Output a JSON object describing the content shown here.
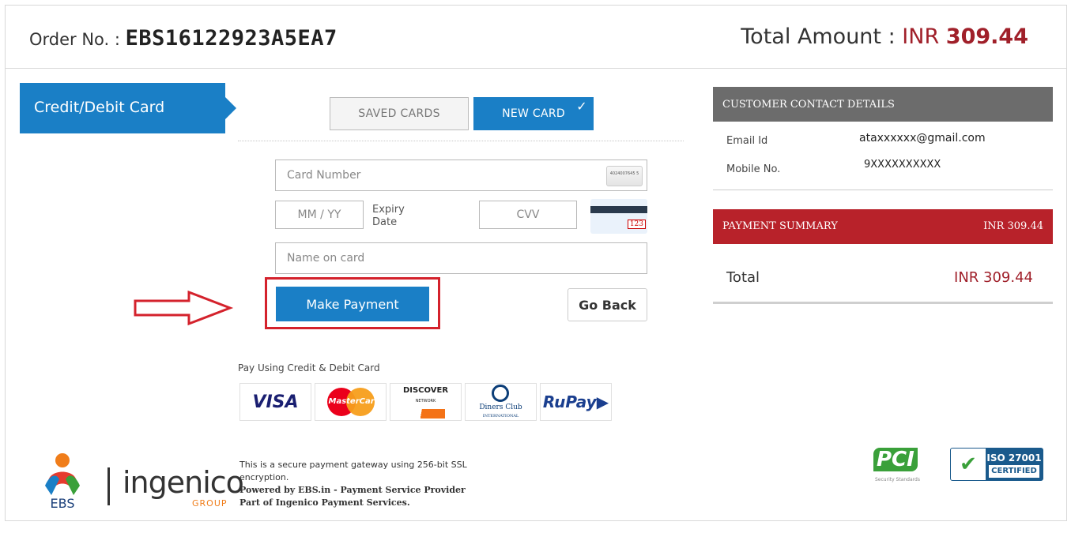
{
  "header": {
    "order_label": "Order No. : ",
    "order_number": "EBS16122923A5EA7",
    "total_label": "Total Amount : ",
    "total_currency": "INR ",
    "total_amount": "309.44"
  },
  "side_tab": {
    "label": "Credit/Debit Card"
  },
  "card_tabs": {
    "saved": "SAVED CARDS",
    "new": "NEW CARD",
    "new_check": "✓"
  },
  "form": {
    "card_number_placeholder": "Card Number",
    "mmyy_placeholder": "MM / YY",
    "expiry_label": "Expiry Date",
    "cvv_placeholder": "CVV",
    "name_placeholder": "Name on card",
    "cvv_sample": "123",
    "card_sample": "4024007645 5"
  },
  "buttons": {
    "make_payment": "Make Payment",
    "go_back": "Go Back"
  },
  "pay_using": {
    "label": "Pay Using Credit & Debit Card",
    "brands": {
      "visa": "VISA",
      "mastercard": "MasterCard",
      "discover": "DISCOVER",
      "discover_sub": "NETWORK",
      "diners": "Diners Club",
      "diners_sub": "INTERNATIONAL",
      "rupay": "RuPay"
    }
  },
  "footer": {
    "ebs": "EBS",
    "ingenico": "ingenico",
    "group": "GROUP",
    "secure_line1": "This is a secure payment gateway using 256-bit SSL encryption.",
    "secure_line2": "Powered by EBS.in - Payment Service Provider",
    "secure_line3": "Part of Ingenico Payment Services.",
    "pci": "PCI",
    "pci_sub": "Security Standards",
    "iso_line1": "ISO 27001",
    "iso_line2": "CERTIFIED"
  },
  "contact": {
    "header": "CUSTOMER CONTACT DETAILS",
    "email_label": "Email Id",
    "email_value": "ataxxxxxx@gmail.com",
    "mobile_label": "Mobile No.",
    "mobile_value": "9XXXXXXXXXX"
  },
  "summary": {
    "header": "PAYMENT SUMMARY",
    "header_amount": "INR 309.44",
    "total_label": "Total",
    "total_amount": "INR 309.44"
  },
  "colors": {
    "primary": "#1a7fc6",
    "accent_red": "#b8222a",
    "highlight": "#d4222c",
    "grey_header": "#6c6c6c"
  }
}
